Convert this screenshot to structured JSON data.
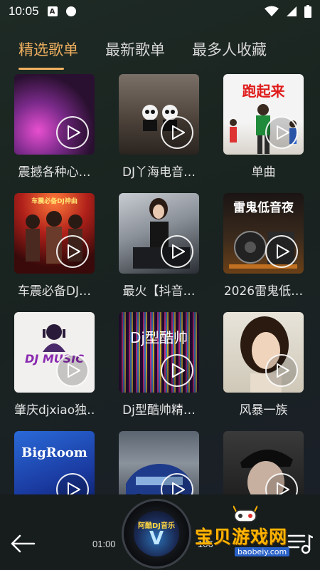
{
  "status_bar": {
    "time": "10:05",
    "notification_letter": "A"
  },
  "tabs": [
    {
      "label": "精选歌单",
      "active": true
    },
    {
      "label": "最新歌单",
      "active": false
    },
    {
      "label": "最多人收藏",
      "active": false
    }
  ],
  "playlists": [
    {
      "title": "震撼各种心…",
      "art_text": ""
    },
    {
      "title": "DJ丫海电音…",
      "art_text": ""
    },
    {
      "title": "单曲",
      "art_text": "跑起来"
    },
    {
      "title": "车震必备DJ…",
      "art_text": "车震必备DJ神曲"
    },
    {
      "title": "最火【抖音…",
      "art_text": ""
    },
    {
      "title": "2026雷鬼低…",
      "art_text": "雷鬼低音夜"
    },
    {
      "title": "肇庆djxiao独…",
      "art_text": "DJ MUSIC"
    },
    {
      "title": "Dj型酷帅精…",
      "art_text": "Dj型酷帅"
    },
    {
      "title": "风暴一族",
      "art_text": ""
    },
    {
      "title": "",
      "art_text": "BigRoom"
    },
    {
      "title": "",
      "art_text": ""
    },
    {
      "title": "",
      "art_text": ""
    }
  ],
  "player": {
    "elapsed": "01:00",
    "duration": "106",
    "disc_label": "阿酷DJ音乐"
  },
  "watermark": {
    "text": "宝贝游戏网",
    "url": "baobeiy.com"
  },
  "colors": {
    "accent": "#f0b060",
    "background": "#1b2420"
  }
}
